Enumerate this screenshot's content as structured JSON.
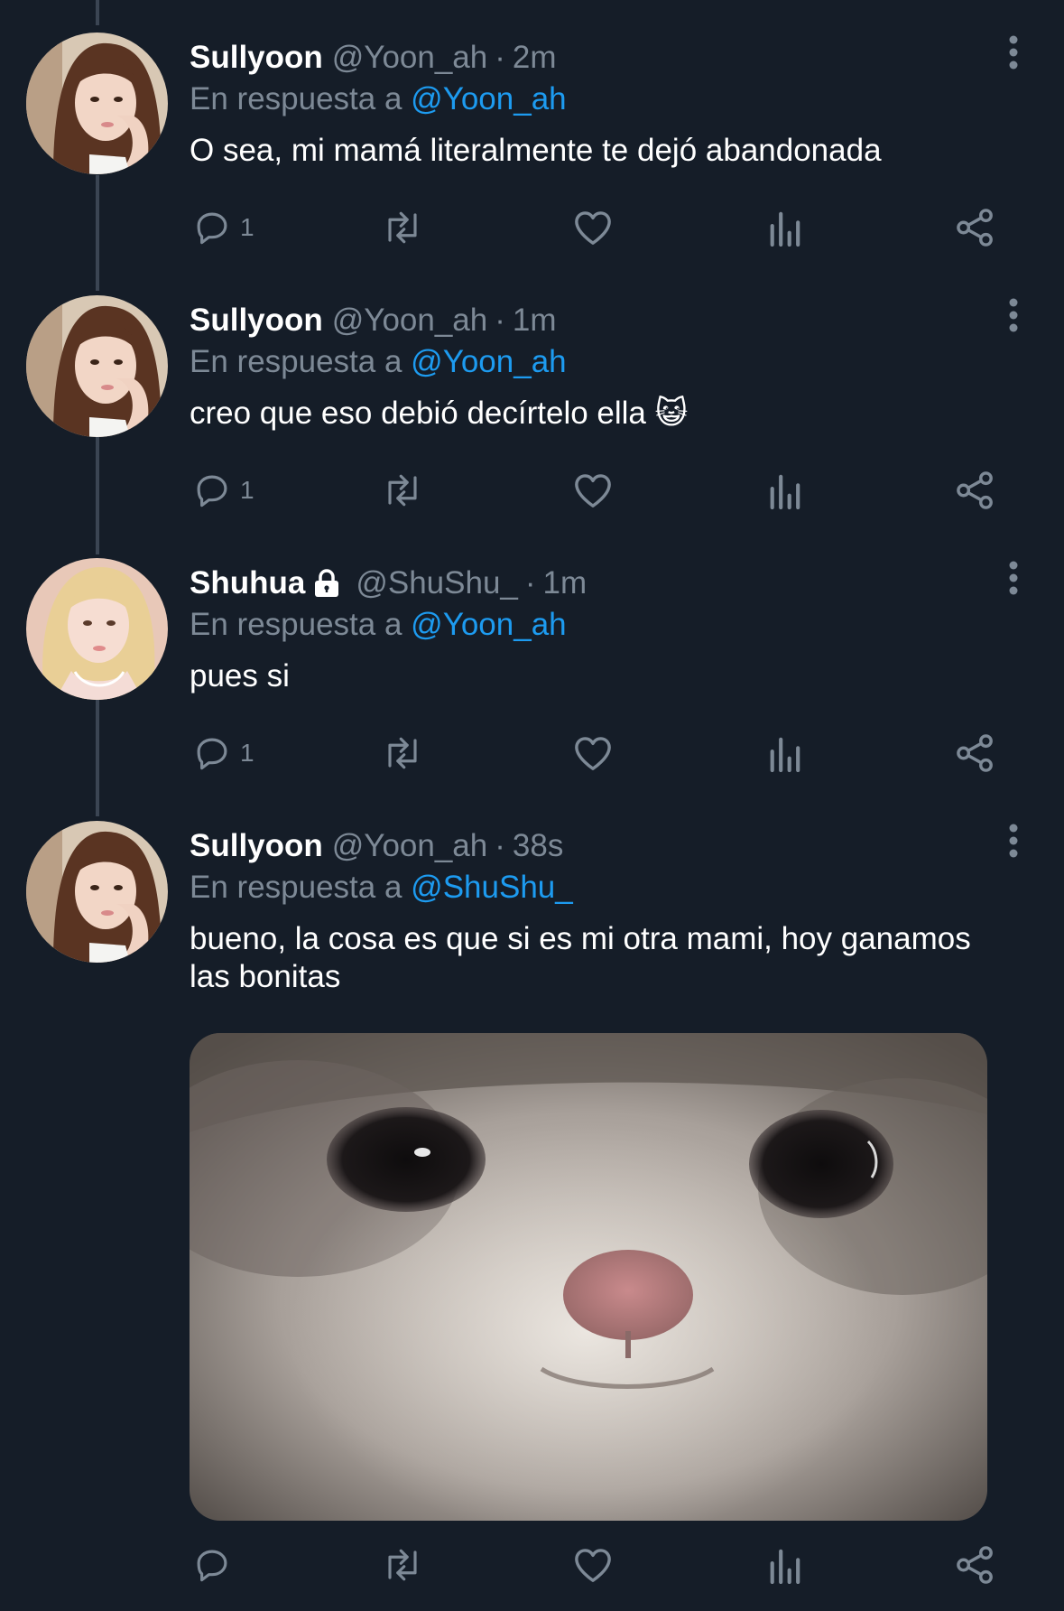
{
  "reply_prefix": "En respuesta a",
  "tweets": [
    {
      "name": "Sullyoon",
      "handle": "@Yoon_ah",
      "separator": "·",
      "time": "2m",
      "reply_to": "@Yoon_ah",
      "text": "O sea, mi mamá literalmente te dejó abandonada",
      "reply_count": "1"
    },
    {
      "name": "Sullyoon",
      "handle": "@Yoon_ah",
      "separator": "·",
      "time": "1m",
      "reply_to": "@Yoon_ah",
      "text": "creo que eso debió decírtelo ella 😺",
      "reply_count": "1"
    },
    {
      "name": "Shuhua",
      "handle": "@ShuShu_",
      "separator": "·",
      "time": "1m",
      "reply_to": "@Yoon_ah",
      "text": "pues si",
      "reply_count": "1",
      "protected": true
    },
    {
      "name": "Sullyoon",
      "handle": "@Yoon_ah",
      "separator": "·",
      "time": "38s",
      "reply_to": "@ShuShu_",
      "text": "bueno, la cosa es que si es mi otra mami, hoy ganamos las bonitas",
      "reply_count": ""
    }
  ],
  "colors": {
    "background": "#151d28",
    "link": "#1d9bf0",
    "muted": "#7d8996",
    "thread_line": "#3b4553"
  }
}
